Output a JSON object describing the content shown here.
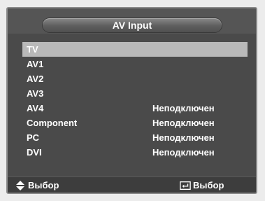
{
  "header": {
    "title": "AV Input"
  },
  "inputs": [
    {
      "name": "TV",
      "status": ""
    },
    {
      "name": "AV1",
      "status": ""
    },
    {
      "name": "AV2",
      "status": ""
    },
    {
      "name": "AV3",
      "status": ""
    },
    {
      "name": "AV4",
      "status": "Неподключен"
    },
    {
      "name": "Component",
      "status": "Неподключен"
    },
    {
      "name": "PC",
      "status": "Неподключен"
    },
    {
      "name": "DVI",
      "status": "Неподключен"
    }
  ],
  "selected_index": 0,
  "footer": {
    "navigate_icon": "up-down-arrows-icon",
    "navigate_label": "Выбор",
    "enter_icon": "enter-icon",
    "enter_label": "Выбор"
  },
  "colors": {
    "background": "#4a4a4a",
    "highlight": "#b9b9b9",
    "text": "#ffffff"
  }
}
